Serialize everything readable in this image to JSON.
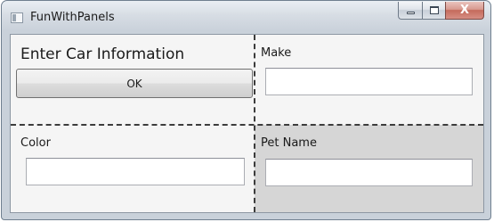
{
  "window": {
    "title": "FunWithPanels",
    "caption_buttons": {
      "minimize_icon": "minimize-icon",
      "maximize_icon": "maximize-icon",
      "close_glyph": "X"
    }
  },
  "panels": {
    "top_left": {
      "header": "Enter Car Information",
      "ok_button_label": "OK"
    },
    "top_right": {
      "label": "Make",
      "value": ""
    },
    "bottom_left": {
      "label": "Color",
      "value": ""
    },
    "bottom_right": {
      "label": "Pet Name",
      "value": "",
      "background": "#d6d6d6"
    }
  },
  "colors": {
    "client_background": "#f5f5f5",
    "divider": "#3c3c3c",
    "close_button": "#c46a5c"
  }
}
